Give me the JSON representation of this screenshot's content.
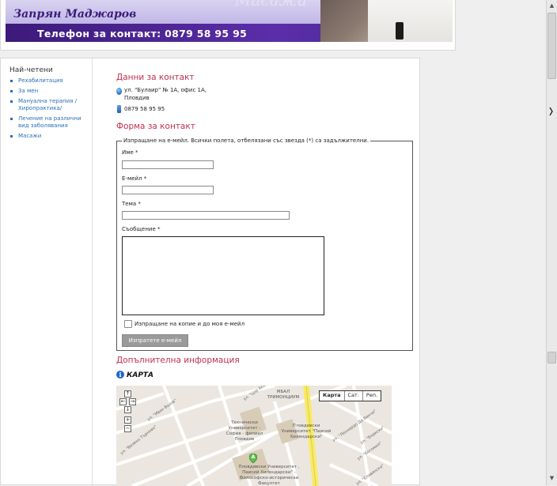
{
  "header": {
    "name": "Запрян Маджаров",
    "phone_line": "Телефон за контакт: 0879 58 95 95",
    "watermark": "Масажи"
  },
  "sidebar": {
    "title": "Най-четени",
    "items": [
      {
        "label": "Рехабилитация"
      },
      {
        "label": "За мен"
      },
      {
        "label": "Мануална терапия / Хиропрактика/"
      },
      {
        "label": "Лечение на различни вид заболявания"
      },
      {
        "label": "Масажи"
      }
    ]
  },
  "contact": {
    "heading": "Данни за контакт",
    "address_line1": "ул. \"Булаир\" № 1А, офис 1А,",
    "address_line2": "Пловдив",
    "phone": "0879 58 95 95"
  },
  "form": {
    "heading": "Форма за контакт",
    "legend": "Изпращане на е-мейл. Всички полета, отбелязани със звезда (*) са задължителни.",
    "name_label": "Име *",
    "name_value": "",
    "email_label": "Е-мейл *",
    "email_value": "",
    "subject_label": "Тема *",
    "subject_value": "",
    "message_label": "Съобщение *",
    "message_value": "",
    "copy_label": "Изпращане на копие и до моя е-мейл",
    "copy_checked": false,
    "submit_label": "Изпратете е-мейл"
  },
  "additional": {
    "heading": "Допълнителна информация",
    "map_title": "КАРТА"
  },
  "map": {
    "types": [
      "Карта",
      "Сат.",
      "Реп."
    ],
    "active_type": "Карта",
    "controls": {
      "up": "↑",
      "left": "←",
      "right": "→",
      "down": "↓",
      "zoom_in": "+",
      "zoom_out": "−"
    },
    "labels": {
      "mbal": "МБАЛ ТРИМОНЦИУМ",
      "tech_univ": "Технически Университет - София - филиал Пловдив",
      "plovdiv_univ": "Пловдивски Университет \"Паисий Хилендарски\"",
      "phil_hist": "Пловдивски Университет , Паисий Хилендарски\" - Философско-исторически Факултет",
      "marker_letter": "A"
    },
    "streets": {
      "asen": "ул. \"Цар Асен\"",
      "velika": "ул. \"Велико Търново\"",
      "ivan_vazov": "ул. \"Иван Вазов\"",
      "leonardo": "ул. \"Леонардо Да Винчи\"",
      "bogomil": "ул. \"Богомил\"",
      "boris": "ул. \"Бориска\"",
      "slavyanska": "ул. \"Славянска\""
    }
  },
  "colors": {
    "heading": "#c03050",
    "link": "#2a6fb6",
    "banner_dark": "#3c1a7a"
  }
}
